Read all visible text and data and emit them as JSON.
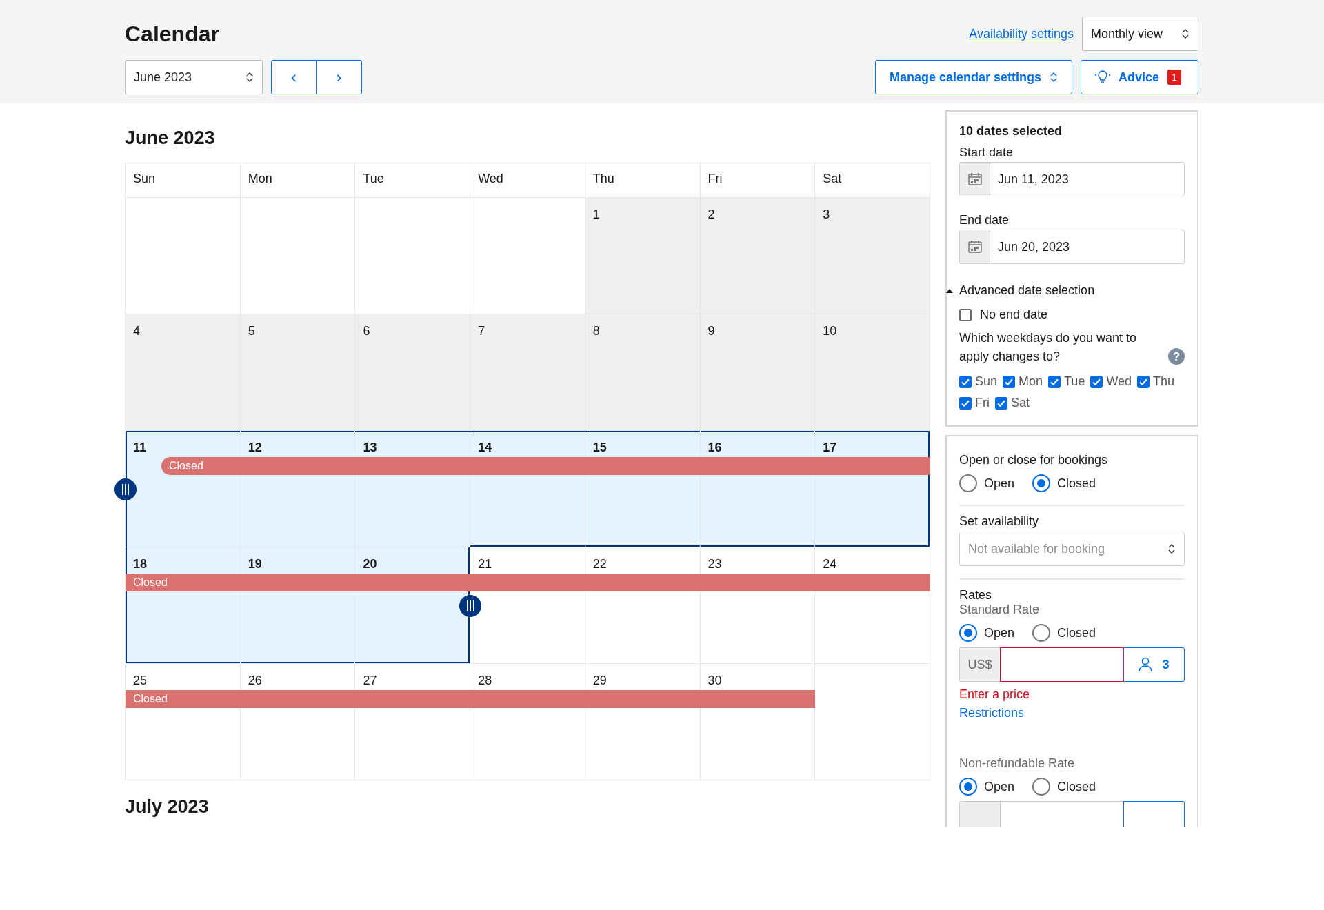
{
  "header": {
    "title": "Calendar",
    "month_select": "June 2023",
    "prev_button": "‹",
    "next_button": "›",
    "availability_link": "Availability settings",
    "view_select": "Monthly view",
    "manage_button": "Manage calendar settings",
    "advice_button": {
      "label": "Advice",
      "badge": "1"
    }
  },
  "calendar": {
    "title": "June 2023",
    "weekdays": [
      "Sun",
      "Mon",
      "Tue",
      "Wed",
      "Thu",
      "Fri",
      "Sat"
    ],
    "weeks": [
      {
        "cells": [
          {
            "kind": "blank"
          },
          {
            "kind": "blank"
          },
          {
            "kind": "blank"
          },
          {
            "kind": "blank"
          },
          {
            "kind": "day",
            "day": "1",
            "past": true,
            "selected": false
          },
          {
            "kind": "day",
            "day": "2",
            "past": true,
            "selected": false
          },
          {
            "kind": "day",
            "day": "3",
            "past": true,
            "selected": false
          }
        ]
      },
      {
        "cells": [
          {
            "kind": "day",
            "day": "4",
            "past": true,
            "selected": false
          },
          {
            "kind": "day",
            "day": "5",
            "past": true,
            "selected": false
          },
          {
            "kind": "day",
            "day": "6",
            "past": true,
            "selected": false
          },
          {
            "kind": "day",
            "day": "7",
            "past": true,
            "selected": false
          },
          {
            "kind": "day",
            "day": "8",
            "past": true,
            "selected": false
          },
          {
            "kind": "day",
            "day": "9",
            "past": true,
            "selected": false
          },
          {
            "kind": "day",
            "day": "10",
            "past": true,
            "selected": false
          }
        ]
      },
      {
        "bar": {
          "label": "Closed",
          "rounded_start": true
        },
        "cells": [
          {
            "kind": "day",
            "day": "11",
            "past": false,
            "selected": true
          },
          {
            "kind": "day",
            "day": "12",
            "past": false,
            "selected": true
          },
          {
            "kind": "day",
            "day": "13",
            "past": false,
            "selected": true
          },
          {
            "kind": "day",
            "day": "14",
            "past": false,
            "selected": true
          },
          {
            "kind": "day",
            "day": "15",
            "past": false,
            "selected": true
          },
          {
            "kind": "day",
            "day": "16",
            "past": false,
            "selected": true
          },
          {
            "kind": "day",
            "day": "17",
            "past": false,
            "selected": true
          }
        ]
      },
      {
        "bar": {
          "label": "Closed",
          "rounded_start": false
        },
        "cells": [
          {
            "kind": "day",
            "day": "18",
            "past": false,
            "selected": true
          },
          {
            "kind": "day",
            "day": "19",
            "past": false,
            "selected": true
          },
          {
            "kind": "day",
            "day": "20",
            "past": false,
            "selected": true
          },
          {
            "kind": "day",
            "day": "21",
            "past": false,
            "selected": false
          },
          {
            "kind": "day",
            "day": "22",
            "past": false,
            "selected": false
          },
          {
            "kind": "day",
            "day": "23",
            "past": false,
            "selected": false
          },
          {
            "kind": "day",
            "day": "24",
            "past": false,
            "selected": false
          }
        ]
      },
      {
        "bar": {
          "label": "Closed",
          "rounded_start": false
        },
        "cells": [
          {
            "kind": "day",
            "day": "25",
            "past": false,
            "selected": false
          },
          {
            "kind": "day",
            "day": "26",
            "past": false,
            "selected": false
          },
          {
            "kind": "day",
            "day": "27",
            "past": false,
            "selected": false
          },
          {
            "kind": "day",
            "day": "28",
            "past": false,
            "selected": false
          },
          {
            "kind": "day",
            "day": "29",
            "past": false,
            "selected": false
          },
          {
            "kind": "day",
            "day": "30",
            "past": false,
            "selected": false
          },
          {
            "kind": "blank"
          }
        ]
      }
    ]
  },
  "next_month_title": "July 2023",
  "selection_panel": {
    "title": "10 dates selected",
    "start_label": "Start date",
    "start_value": "Jun 11, 2023",
    "end_label": "End date",
    "end_value": "Jun 20, 2023",
    "advanced": {
      "label": "Advanced date selection",
      "expanded": true
    },
    "no_end_date": {
      "label": "No end date",
      "checked": false
    },
    "question": "Which weekdays do you want to apply changes to?",
    "help": "?",
    "weekdays": [
      {
        "label": "Sun",
        "checked": true
      },
      {
        "label": "Mon",
        "checked": true
      },
      {
        "label": "Tue",
        "checked": true
      },
      {
        "label": "Wed",
        "checked": true
      },
      {
        "label": "Thu",
        "checked": true
      },
      {
        "label": "Fri",
        "checked": true
      },
      {
        "label": "Sat",
        "checked": true
      }
    ]
  },
  "availability_panel": {
    "bookings_label": "Open or close for bookings",
    "bookings_options": [
      {
        "label": "Open",
        "selected": false
      },
      {
        "label": "Closed",
        "selected": true
      }
    ],
    "availability_label": "Set availability",
    "availability_select": "Not available for booking",
    "rates_label": "Rates",
    "rates": [
      {
        "name": "Standard Rate",
        "options": [
          {
            "label": "Open",
            "selected": true
          },
          {
            "label": "Closed",
            "selected": false
          }
        ],
        "currency": "US$",
        "invalid": true,
        "guests": "3",
        "error": "Enter a price",
        "link": "Restrictions"
      },
      {
        "name": "Non-refundable Rate",
        "options": [
          {
            "label": "Open",
            "selected": true
          },
          {
            "label": "Closed",
            "selected": false
          }
        ],
        "invalid": false
      }
    ]
  }
}
